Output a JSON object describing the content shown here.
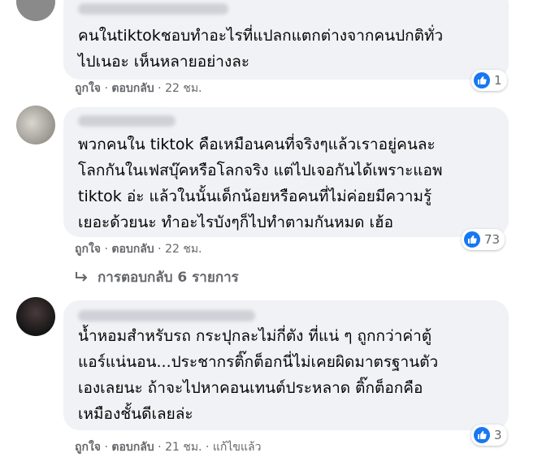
{
  "comments": [
    {
      "text": "คนในtiktokชอบทำอะไรที่แปลกแตกต่างจากคนปกติทั่ว\nไปเนอะ เห็นหลายอย่างละ",
      "like_label": "ถูกใจ",
      "reply_label": "ตอบกลับ",
      "time": "22 ชม.",
      "reactions": "1"
    },
    {
      "text": "พวกคนใน tiktok คือเหมือนคนที่จริงๆแล้วเราอยู่คนละ\nโลกกันในเฟสบุ๊คหรือโลกจริง แต่ไปเจอกันได้เพราะแอพ\ntiktok อ่ะ แล้วในนั้นเด็กน้อยหรือคนที่ไม่ค่อยมีความรู้\nเยอะด้วยนะ ทำอะไรบังๆก็ไปทำตามกันหมด เฮ้อ",
      "like_label": "ถูกใจ",
      "reply_label": "ตอบกลับ",
      "time": "22 ชม.",
      "reactions": "73"
    },
    {
      "text": "น้ำหอมสำหรับรถ กระปุกละไม่กี่ตัง ที่แน่ ๆ ถูกกว่าค่าตู้\nแอร์แน่นอน...ประชากรติ๊กต็อกนี่ไม่เคยผิดมาตรฐานตัว\nเองเลยนะ ถ้าจะไปหาคอนเทนต์ประหลาด ติ๊กต็อกคือ\nเหมืองชั้นดีเลยล่ะ",
      "like_label": "ถูกใจ",
      "reply_label": "ตอบกลับ",
      "time": "21 ชม.",
      "edited": "แก้ไขแล้ว",
      "reactions": "3"
    }
  ],
  "replies_link": "การตอบกลับ 6 รายการ",
  "colors": {
    "like_blue": "#1877f2",
    "bubble": "#f0f2f5",
    "meta": "#65676b"
  },
  "icons": [
    "like-icon",
    "reply-arrow-icon"
  ]
}
